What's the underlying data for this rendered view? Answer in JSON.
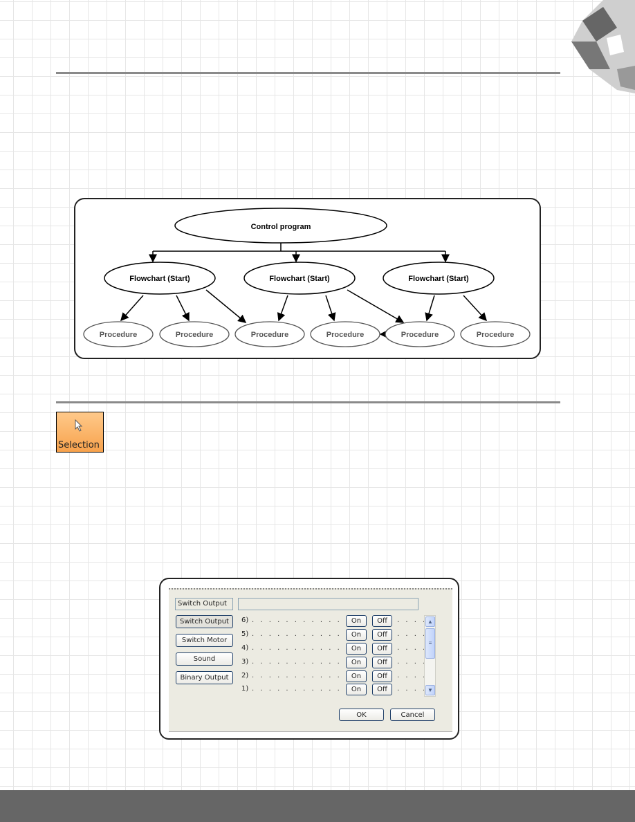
{
  "diagram": {
    "root": "Control program",
    "flowcharts": [
      "Flowchart (Start)",
      "Flowchart (Start)",
      "Flowchart (Start)"
    ],
    "procedures": [
      "Procedure",
      "Procedure",
      "Procedure",
      "Procedure",
      "Procedure",
      "Procedure"
    ]
  },
  "selection_tool": {
    "label": "Selection",
    "icon": "cursor-arrow-icon",
    "color": "#f7a24c"
  },
  "dialog": {
    "title_label": "Switch Output",
    "title_value": "",
    "categories": [
      "Switch Output",
      "Switch Motor",
      "Sound",
      "Binary Output"
    ],
    "outputs": [
      {
        "label": "6)",
        "on": "On",
        "off": "Off"
      },
      {
        "label": "5)",
        "on": "On",
        "off": "Off"
      },
      {
        "label": "4)",
        "on": "On",
        "off": "Off"
      },
      {
        "label": "3)",
        "on": "On",
        "off": "Off"
      },
      {
        "label": "2)",
        "on": "On",
        "off": "Off"
      },
      {
        "label": "1)",
        "on": "On",
        "off": "Off"
      }
    ],
    "dots": ". . . . . . . . . . . . . . . . . . . . . .",
    "ok": "OK",
    "cancel": "Cancel"
  }
}
